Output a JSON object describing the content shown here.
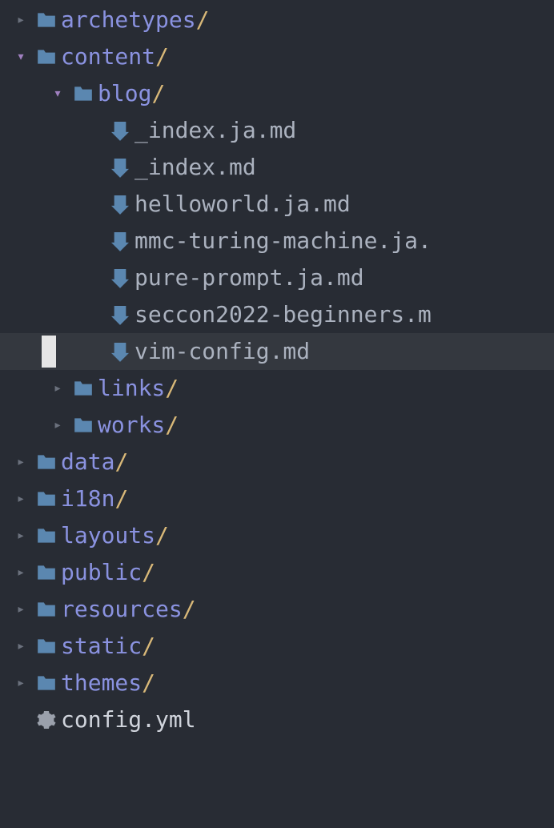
{
  "tree": [
    {
      "type": "folder",
      "name": "archetypes",
      "depth": 0,
      "expanded": false
    },
    {
      "type": "folder",
      "name": "content",
      "depth": 0,
      "expanded": true
    },
    {
      "type": "folder",
      "name": "blog",
      "depth": 1,
      "expanded": true
    },
    {
      "type": "file",
      "name": "_index.ja.md",
      "depth": 2,
      "icon": "markdown"
    },
    {
      "type": "file",
      "name": "_index.md",
      "depth": 2,
      "icon": "markdown"
    },
    {
      "type": "file",
      "name": "helloworld.ja.md",
      "depth": 2,
      "icon": "markdown"
    },
    {
      "type": "file",
      "name": "mmc-turing-machine.ja.",
      "depth": 2,
      "icon": "markdown"
    },
    {
      "type": "file",
      "name": "pure-prompt.ja.md",
      "depth": 2,
      "icon": "markdown"
    },
    {
      "type": "file",
      "name": "seccon2022-beginners.m",
      "depth": 2,
      "icon": "markdown"
    },
    {
      "type": "file",
      "name": "vim-config.md",
      "depth": 2,
      "icon": "markdown",
      "selected": true
    },
    {
      "type": "folder",
      "name": "links",
      "depth": 1,
      "expanded": false
    },
    {
      "type": "folder",
      "name": "works",
      "depth": 1,
      "expanded": false
    },
    {
      "type": "folder",
      "name": "data",
      "depth": 0,
      "expanded": false
    },
    {
      "type": "folder",
      "name": "i18n",
      "depth": 0,
      "expanded": false
    },
    {
      "type": "folder",
      "name": "layouts",
      "depth": 0,
      "expanded": false
    },
    {
      "type": "folder",
      "name": "public",
      "depth": 0,
      "expanded": false
    },
    {
      "type": "folder",
      "name": "resources",
      "depth": 0,
      "expanded": false
    },
    {
      "type": "folder",
      "name": "static",
      "depth": 0,
      "expanded": false
    },
    {
      "type": "folder",
      "name": "themes",
      "depth": 0,
      "expanded": false
    },
    {
      "type": "file",
      "name": "config.yml",
      "depth": 0,
      "icon": "gear"
    }
  ],
  "slash": "/"
}
